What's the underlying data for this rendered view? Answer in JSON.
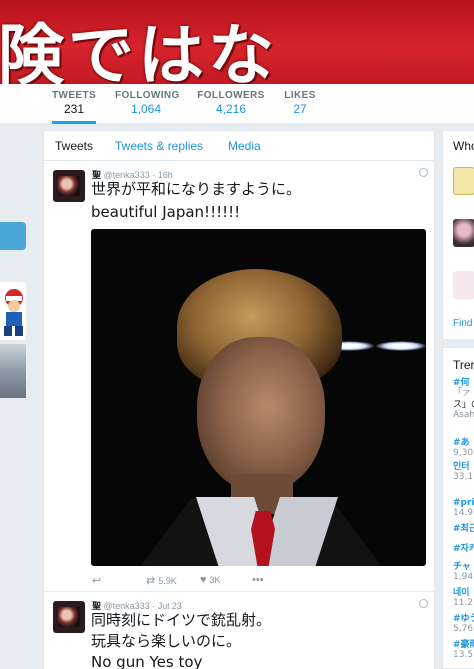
{
  "banner": {
    "text": "険ではな"
  },
  "profile_nav": {
    "stats": [
      {
        "label": "TWEETS",
        "value": "231"
      },
      {
        "label": "FOLLOWING",
        "value": "1,064"
      },
      {
        "label": "FOLLOWERS",
        "value": "4,216"
      },
      {
        "label": "LIKES",
        "value": "27"
      }
    ]
  },
  "timeline": {
    "tabs": [
      "Tweets",
      "Tweets & replies",
      "Media"
    ],
    "tweets": [
      {
        "name": "聖",
        "handle": "@tenka333",
        "time": "· 16h",
        "lines": [
          "世界が平和になりますように。",
          "beautiful Japan!!!!!!"
        ],
        "retweets": "5.9K",
        "likes": "3K"
      },
      {
        "name": "聖",
        "handle": "@tenka333",
        "time": "· Jul 23",
        "lines": [
          "同時刻にドイツで銃乱射。",
          "玩具なら楽しいのに。",
          "No gun Yes toy"
        ]
      }
    ]
  },
  "right_sidebar": {
    "who_to_follow_title": "Who",
    "find_link": "Find",
    "trends_title": "Trer",
    "trends": [
      {
        "tag": "#何",
        "count": "「ァ"
      },
      {
        "tag": "ス」の",
        "count": "Asah"
      },
      {
        "tag": "#あ",
        "count": "9,30"
      },
      {
        "tag": "인터",
        "count": "33.1"
      },
      {
        "tag": "#prij",
        "count": "14.9"
      },
      {
        "tag": "#최근",
        "count": ""
      },
      {
        "tag": "#자카",
        "count": ""
      },
      {
        "tag": "チャ",
        "count": "1,94"
      },
      {
        "tag": "네이",
        "count": "11.2"
      },
      {
        "tag": "#ゆう",
        "count": "5,76"
      },
      {
        "tag": "#豪雨",
        "count": "13.5"
      }
    ]
  },
  "icons": {
    "reply": "↩",
    "retweet": "⇄",
    "like": "♥",
    "more": "•••"
  }
}
